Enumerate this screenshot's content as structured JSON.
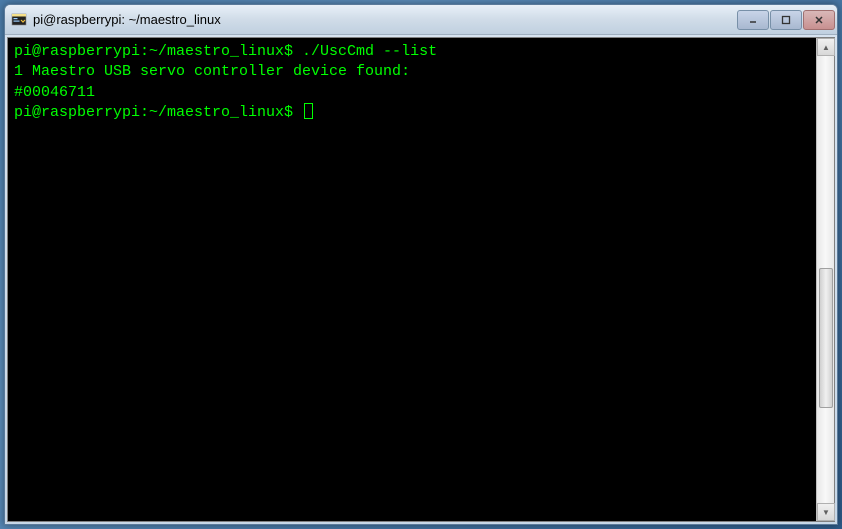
{
  "window": {
    "title": "pi@raspberrypi: ~/maestro_linux"
  },
  "terminal": {
    "lines": [
      {
        "prompt": "pi@raspberrypi:~/maestro_linux$ ",
        "command": "./UscCmd --list"
      },
      {
        "text": "1 Maestro USB servo controller device found:"
      },
      {
        "text": "#00046711"
      },
      {
        "prompt": "pi@raspberrypi:~/maestro_linux$ ",
        "cursor": true
      }
    ]
  }
}
